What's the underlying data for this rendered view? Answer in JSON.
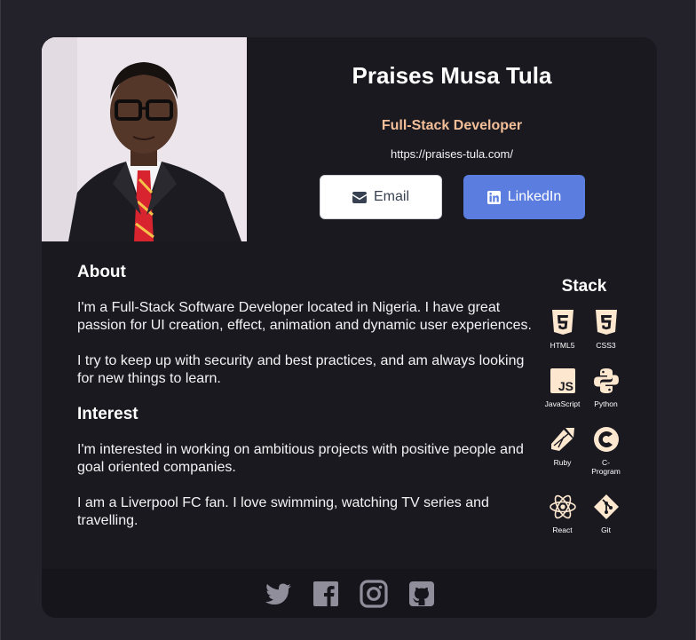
{
  "profile": {
    "name": "Praises Musa Tula",
    "role": "Full-Stack Developer",
    "website": "https://praises-tula.com/"
  },
  "buttons": {
    "email_label": "Email",
    "linkedin_label": "LinkedIn"
  },
  "about": {
    "heading": "About",
    "paragraphs": [
      "I'm a Full-Stack Software Developer located in Nigeria. I have great passion for UI creation, effect, animation and dynamic user experiences.",
      "I try to keep up with security and best practices, and am always looking for new things to learn."
    ]
  },
  "interest": {
    "heading": "Interest",
    "paragraphs": [
      "I'm interested in working on ambitious projects with positive people and goal oriented companies.",
      "I am a Liverpool FC fan. I love swimming, watching TV series and travelling."
    ]
  },
  "stack": {
    "heading": "Stack",
    "items": [
      {
        "label": "HTML5",
        "icon": "html5-icon"
      },
      {
        "label": "CSS3",
        "icon": "css3-icon"
      },
      {
        "label": "JavaScript",
        "icon": "javascript-icon"
      },
      {
        "label": "Python",
        "icon": "python-icon"
      },
      {
        "label": "Ruby",
        "icon": "ruby-icon"
      },
      {
        "label": "C-Program",
        "icon": "c-program-icon"
      },
      {
        "label": "React",
        "icon": "react-icon"
      },
      {
        "label": "Git",
        "icon": "git-icon"
      }
    ]
  },
  "footer": {
    "icons": [
      "twitter-icon",
      "facebook-icon",
      "instagram-icon",
      "github-icon"
    ]
  },
  "colors": {
    "page_bg": "#23222b",
    "card_bg": "#1a1920",
    "footer_bg": "#16151c",
    "accent_role": "#f3bf99",
    "linkedin_button": "#5b7de0",
    "icon_fill": "#fde7cf",
    "social_icon": "#918e9b"
  }
}
